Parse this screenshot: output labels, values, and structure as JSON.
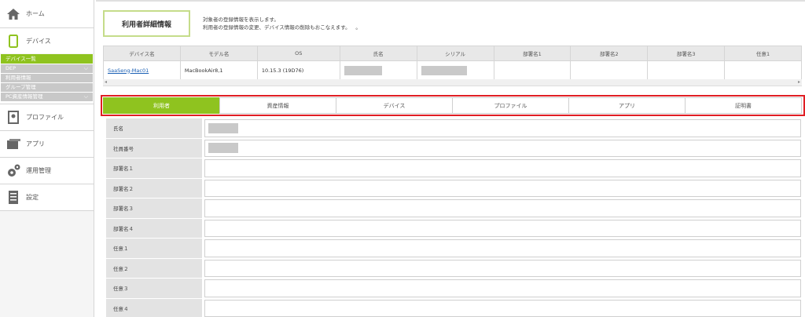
{
  "sidebar": {
    "home": {
      "label": "ホーム",
      "icon": "home-icon"
    },
    "device": {
      "label": "デバイス",
      "icon": "smartphone-icon"
    },
    "sub_items": [
      {
        "label": "デバイス一覧",
        "active": true
      },
      {
        "label": "DEP",
        "chevron": true
      },
      {
        "label": "利用者情報"
      },
      {
        "label": "グループ管理"
      },
      {
        "label": "PC資産情報管理",
        "chevron": true
      }
    ],
    "profile": {
      "label": "プロファイル",
      "icon": "profile-icon"
    },
    "app": {
      "label": "アプリ",
      "icon": "app-icon"
    },
    "ops": {
      "label": "運用管理",
      "icon": "gear-icon"
    },
    "settings": {
      "label": "設定",
      "icon": "settings-doc-icon"
    }
  },
  "header": {
    "title": "利用者詳細情報",
    "desc_line1": "対象者の登録情報を表示します。",
    "desc_line2": "利用者の登録情報の変更、デバイス情報の削除もおこなえます。",
    "desc_dot": "。"
  },
  "device_table": {
    "columns": [
      "デバイス名",
      "モデル名",
      "OS",
      "氏名",
      "シリアル",
      "部署名1",
      "部署名2",
      "部署名3",
      "任意1"
    ],
    "row": {
      "device_name": "SaaSeng-Mac01",
      "model": "MacBookAir8,1",
      "os": "10.15.3 (19D76)"
    }
  },
  "tabs": [
    "利用者",
    "資産情報",
    "デバイス",
    "プロファイル",
    "アプリ",
    "証明書"
  ],
  "active_tab": 0,
  "form": {
    "rows": [
      {
        "label": "氏名",
        "masked": true
      },
      {
        "label": "社員番号",
        "masked": true
      },
      {
        "label": "部署名１",
        "masked": false
      },
      {
        "label": "部署名２",
        "masked": false
      },
      {
        "label": "部署名３",
        "masked": false
      },
      {
        "label": "部署名４",
        "masked": false
      },
      {
        "label": "任意１",
        "masked": false
      },
      {
        "label": "任意２",
        "masked": false
      },
      {
        "label": "任意３",
        "masked": false
      },
      {
        "label": "任意４",
        "masked": false
      }
    ]
  },
  "colors": {
    "accent": "#8fc31f",
    "highlight": "#e01e24"
  }
}
